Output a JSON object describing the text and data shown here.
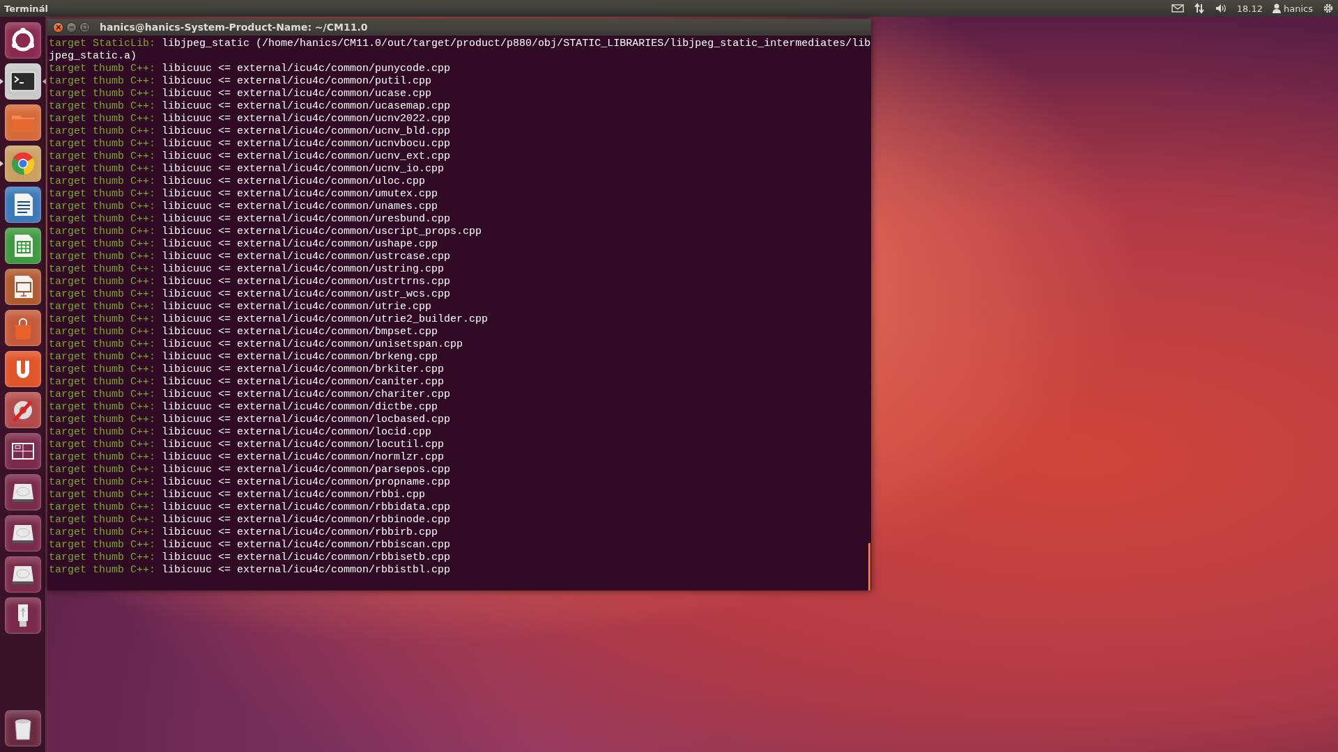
{
  "top_bar": {
    "app_title": "Terminál",
    "time": "18.12",
    "user": "hanics"
  },
  "launcher": [
    {
      "kind": "dash",
      "running": false,
      "focused": false
    },
    {
      "kind": "terminal",
      "running": true,
      "focused": true
    },
    {
      "kind": "files",
      "running": false,
      "focused": false
    },
    {
      "kind": "browser",
      "running": true,
      "focused": false
    },
    {
      "kind": "writer",
      "running": false,
      "focused": false
    },
    {
      "kind": "calc",
      "running": false,
      "focused": false
    },
    {
      "kind": "impress",
      "running": false,
      "focused": false
    },
    {
      "kind": "store",
      "running": false,
      "focused": false
    },
    {
      "kind": "cloud",
      "running": false,
      "focused": false
    },
    {
      "kind": "settings",
      "running": false,
      "focused": false
    },
    {
      "kind": "workspaces",
      "running": false,
      "focused": false
    },
    {
      "kind": "drive",
      "running": false,
      "focused": false
    },
    {
      "kind": "drive",
      "running": false,
      "focused": false
    },
    {
      "kind": "drive",
      "running": false,
      "focused": false
    },
    {
      "kind": "usb",
      "running": false,
      "focused": false
    },
    {
      "kind": "trash",
      "running": false,
      "focused": false
    }
  ],
  "terminal": {
    "title": "hanics@hanics-System-Product-Name: ~/CM11.0",
    "lines": [
      {
        "prompt": "target StaticLib:",
        "text": "libjpeg_static (/home/hanics/CM11.0/out/target/product/p880/obj/STATIC_LIBRARIES/libjpeg_static_intermediates/lib"
      },
      {
        "text": "jpeg_static.a)"
      },
      {
        "prompt": "target thumb C++:",
        "text": "libicuuc <= external/icu4c/common/punycode.cpp"
      },
      {
        "prompt": "target thumb C++:",
        "text": "libicuuc <= external/icu4c/common/putil.cpp"
      },
      {
        "prompt": "target thumb C++:",
        "text": "libicuuc <= external/icu4c/common/ucase.cpp"
      },
      {
        "prompt": "target thumb C++:",
        "text": "libicuuc <= external/icu4c/common/ucasemap.cpp"
      },
      {
        "prompt": "target thumb C++:",
        "text": "libicuuc <= external/icu4c/common/ucnv2022.cpp"
      },
      {
        "prompt": "target thumb C++:",
        "text": "libicuuc <= external/icu4c/common/ucnv_bld.cpp"
      },
      {
        "prompt": "target thumb C++:",
        "text": "libicuuc <= external/icu4c/common/ucnvbocu.cpp"
      },
      {
        "prompt": "target thumb C++:",
        "text": "libicuuc <= external/icu4c/common/ucnv_ext.cpp"
      },
      {
        "prompt": "target thumb C++:",
        "text": "libicuuc <= external/icu4c/common/ucnv_io.cpp"
      },
      {
        "prompt": "target thumb C++:",
        "text": "libicuuc <= external/icu4c/common/uloc.cpp"
      },
      {
        "prompt": "target thumb C++:",
        "text": "libicuuc <= external/icu4c/common/umutex.cpp"
      },
      {
        "prompt": "target thumb C++:",
        "text": "libicuuc <= external/icu4c/common/unames.cpp"
      },
      {
        "prompt": "target thumb C++:",
        "text": "libicuuc <= external/icu4c/common/uresbund.cpp"
      },
      {
        "prompt": "target thumb C++:",
        "text": "libicuuc <= external/icu4c/common/uscript_props.cpp"
      },
      {
        "prompt": "target thumb C++:",
        "text": "libicuuc <= external/icu4c/common/ushape.cpp"
      },
      {
        "prompt": "target thumb C++:",
        "text": "libicuuc <= external/icu4c/common/ustrcase.cpp"
      },
      {
        "prompt": "target thumb C++:",
        "text": "libicuuc <= external/icu4c/common/ustring.cpp"
      },
      {
        "prompt": "target thumb C++:",
        "text": "libicuuc <= external/icu4c/common/ustrtrns.cpp"
      },
      {
        "prompt": "target thumb C++:",
        "text": "libicuuc <= external/icu4c/common/ustr_wcs.cpp"
      },
      {
        "prompt": "target thumb C++:",
        "text": "libicuuc <= external/icu4c/common/utrie.cpp"
      },
      {
        "prompt": "target thumb C++:",
        "text": "libicuuc <= external/icu4c/common/utrie2_builder.cpp"
      },
      {
        "prompt": "target thumb C++:",
        "text": "libicuuc <= external/icu4c/common/bmpset.cpp"
      },
      {
        "prompt": "target thumb C++:",
        "text": "libicuuc <= external/icu4c/common/unisetspan.cpp"
      },
      {
        "prompt": "target thumb C++:",
        "text": "libicuuc <= external/icu4c/common/brkeng.cpp"
      },
      {
        "prompt": "target thumb C++:",
        "text": "libicuuc <= external/icu4c/common/brkiter.cpp"
      },
      {
        "prompt": "target thumb C++:",
        "text": "libicuuc <= external/icu4c/common/caniter.cpp"
      },
      {
        "prompt": "target thumb C++:",
        "text": "libicuuc <= external/icu4c/common/chariter.cpp"
      },
      {
        "prompt": "target thumb C++:",
        "text": "libicuuc <= external/icu4c/common/dictbe.cpp"
      },
      {
        "prompt": "target thumb C++:",
        "text": "libicuuc <= external/icu4c/common/locbased.cpp"
      },
      {
        "prompt": "target thumb C++:",
        "text": "libicuuc <= external/icu4c/common/locid.cpp"
      },
      {
        "prompt": "target thumb C++:",
        "text": "libicuuc <= external/icu4c/common/locutil.cpp"
      },
      {
        "prompt": "target thumb C++:",
        "text": "libicuuc <= external/icu4c/common/normlzr.cpp"
      },
      {
        "prompt": "target thumb C++:",
        "text": "libicuuc <= external/icu4c/common/parsepos.cpp"
      },
      {
        "prompt": "target thumb C++:",
        "text": "libicuuc <= external/icu4c/common/propname.cpp"
      },
      {
        "prompt": "target thumb C++:",
        "text": "libicuuc <= external/icu4c/common/rbbi.cpp"
      },
      {
        "prompt": "target thumb C++:",
        "text": "libicuuc <= external/icu4c/common/rbbidata.cpp"
      },
      {
        "prompt": "target thumb C++:",
        "text": "libicuuc <= external/icu4c/common/rbbinode.cpp"
      },
      {
        "prompt": "target thumb C++:",
        "text": "libicuuc <= external/icu4c/common/rbbirb.cpp"
      },
      {
        "prompt": "target thumb C++:",
        "text": "libicuuc <= external/icu4c/common/rbbiscan.cpp"
      },
      {
        "prompt": "target thumb C++:",
        "text": "libicuuc <= external/icu4c/common/rbbisetb.cpp"
      },
      {
        "prompt": "target thumb C++:",
        "text": "libicuuc <= external/icu4c/common/rbbistbl.cpp"
      }
    ]
  }
}
